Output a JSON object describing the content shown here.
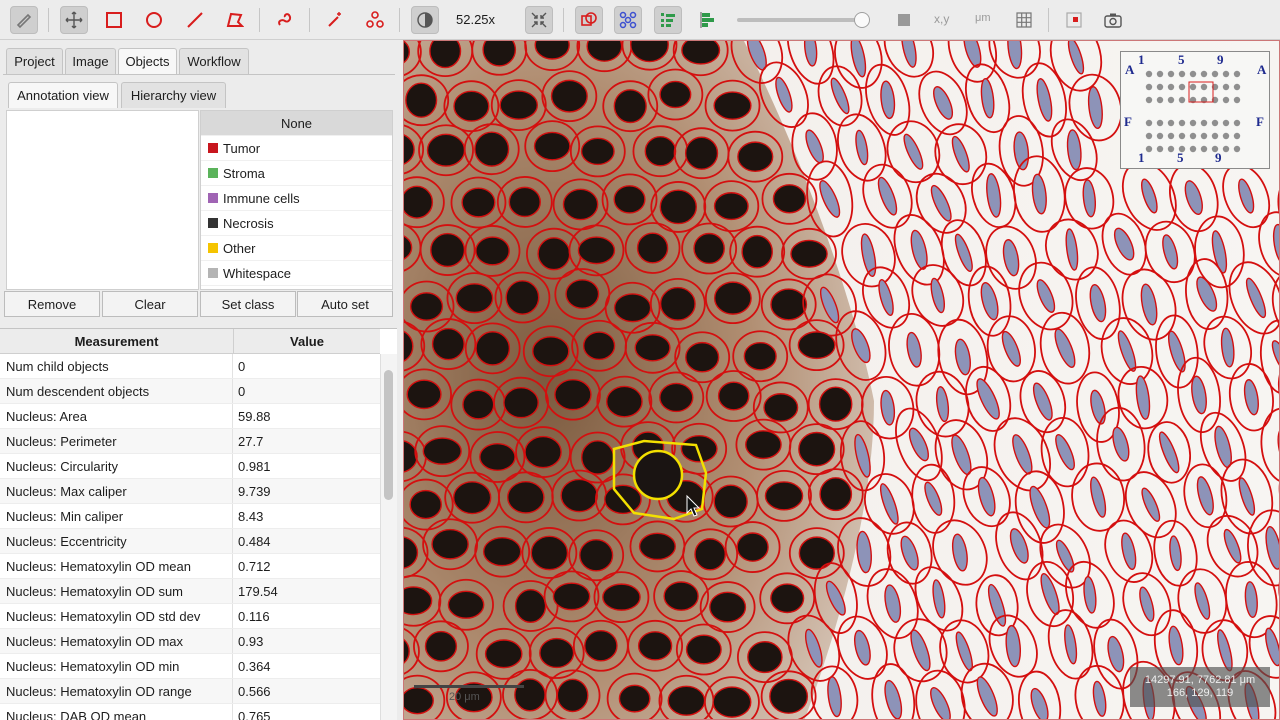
{
  "toolbar": {
    "zoom": "52.25x",
    "coord_label": "x,y",
    "micron_label": "μm",
    "accent": "#d81d1d"
  },
  "tabs": [
    "Project",
    "Image",
    "Objects",
    "Workflow"
  ],
  "subtabs": [
    "Annotation view",
    "Hierarchy view"
  ],
  "classes": [
    {
      "name": "None",
      "color": ""
    },
    {
      "name": "Tumor",
      "color": "#c8161e"
    },
    {
      "name": "Stroma",
      "color": "#5bb35b"
    },
    {
      "name": "Immune cells",
      "color": "#a064b4"
    },
    {
      "name": "Necrosis",
      "color": "#333333"
    },
    {
      "name": "Other",
      "color": "#f5c400"
    },
    {
      "name": "Whitespace",
      "color": "#b4b4b4"
    }
  ],
  "buttons": {
    "remove": "Remove",
    "clear": "Clear",
    "set_class": "Set class",
    "auto_set": "Auto set"
  },
  "measurements": {
    "header": {
      "name": "Measurement",
      "value": "Value"
    },
    "rows": [
      {
        "name": "Num child objects",
        "value": "0"
      },
      {
        "name": "Num descendent objects",
        "value": "0"
      },
      {
        "name": "Nucleus: Area",
        "value": "59.88"
      },
      {
        "name": "Nucleus: Perimeter",
        "value": "27.7"
      },
      {
        "name": "Nucleus: Circularity",
        "value": "0.981"
      },
      {
        "name": "Nucleus: Max caliper",
        "value": "9.739"
      },
      {
        "name": "Nucleus: Min caliper",
        "value": "8.43"
      },
      {
        "name": "Nucleus: Eccentricity",
        "value": "0.484"
      },
      {
        "name": "Nucleus: Hematoxylin OD mean",
        "value": "0.712"
      },
      {
        "name": "Nucleus: Hematoxylin OD sum",
        "value": "179.54"
      },
      {
        "name": "Nucleus: Hematoxylin OD std dev",
        "value": "0.116"
      },
      {
        "name": "Nucleus: Hematoxylin OD max",
        "value": "0.93"
      },
      {
        "name": "Nucleus: Hematoxylin OD min",
        "value": "0.364"
      },
      {
        "name": "Nucleus: Hematoxylin OD range",
        "value": "0.566"
      },
      {
        "name": "Nucleus: DAB OD mean",
        "value": "0.765"
      }
    ]
  },
  "viewer": {
    "overview_labels": [
      "A",
      "1",
      "5",
      "9",
      "A",
      "F",
      "F",
      "1",
      "5",
      "9"
    ],
    "coords_line1": "14297.91, 7762.81 μm",
    "coords_line2": "166, 129, 119",
    "scalebar_label": "20 μm"
  }
}
